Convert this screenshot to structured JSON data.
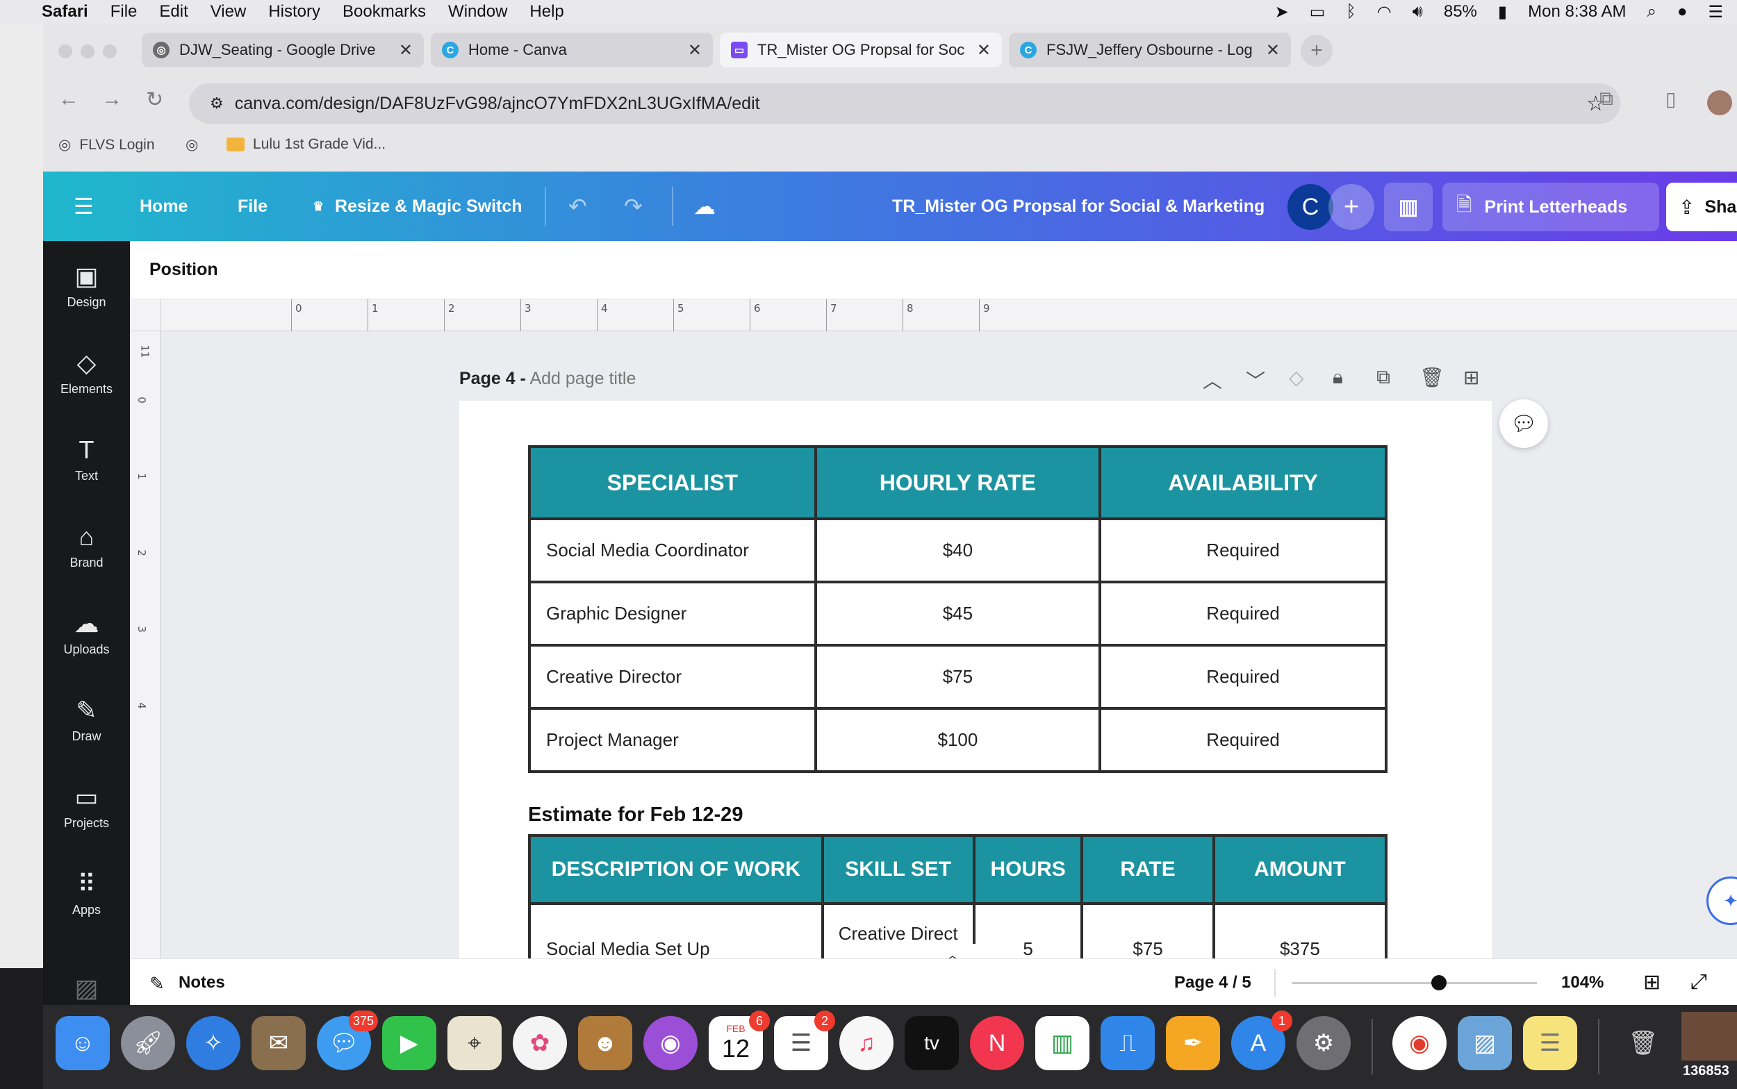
{
  "menubar": {
    "app": "Safari",
    "items": [
      "File",
      "Edit",
      "View",
      "History",
      "Bookmarks",
      "Window",
      "Help"
    ],
    "battery": "85%",
    "clock": "Mon 8:38 AM"
  },
  "browser": {
    "tabs": [
      {
        "label": "DJW_Seating - Google Drive",
        "icon": "globe-icon",
        "color": "#6b6b6b"
      },
      {
        "label": "Home - Canva",
        "icon": "canva-icon",
        "color": "#2aa6e0"
      },
      {
        "label": "TR_Mister OG Propsal for Soc",
        "icon": "canva-doc-icon",
        "color": "#7a4bf0"
      },
      {
        "label": "FSJW_Jeffery Osbourne - Log",
        "icon": "canva-icon",
        "color": "#2aa6e0"
      }
    ],
    "url": "canva.com/design/DAF8UzFvG98/ajncO7YmFDX2nL3UGxIfMA/edit",
    "bookmarks": [
      {
        "label": "FLVS Login"
      },
      {
        "label": ""
      },
      {
        "label": "Lulu 1st Grade Vid..."
      }
    ]
  },
  "canva": {
    "nav": {
      "home": "Home",
      "file": "File",
      "resize": "Resize & Magic Switch",
      "title": "TR_Mister OG Propsal for Social & Marketing",
      "avatar_letter": "C",
      "print": "Print Letterheads",
      "share": "Share"
    },
    "sidebar": [
      {
        "label": "Design",
        "icon": "▣"
      },
      {
        "label": "Elements",
        "icon": "◇"
      },
      {
        "label": "Text",
        "icon": "T"
      },
      {
        "label": "Brand",
        "icon": "⌂"
      },
      {
        "label": "Uploads",
        "icon": "☁"
      },
      {
        "label": "Draw",
        "icon": "✎"
      },
      {
        "label": "Projects",
        "icon": "▭"
      },
      {
        "label": "Apps",
        "icon": "⠿"
      }
    ],
    "position_label": "Position",
    "ruler_h": [
      "0",
      "1",
      "2",
      "3",
      "4",
      "5",
      "6",
      "7",
      "8",
      "9"
    ],
    "ruler_v": [
      "11",
      "0",
      "1",
      "2",
      "3",
      "4"
    ],
    "page_label": "Page 4 -",
    "page_title_placeholder": "Add page title",
    "table1": {
      "headers": [
        "SPECIALIST",
        "HOURLY RATE",
        "AVAILABILITY"
      ],
      "rows": [
        [
          "Social Media Coordinator",
          "$40",
          "Required"
        ],
        [
          "Graphic Designer",
          "$45",
          "Required"
        ],
        [
          "Creative Director",
          "$75",
          "Required"
        ],
        [
          "Project Manager",
          "$100",
          "Required"
        ]
      ]
    },
    "estimate_title": "Estimate for Feb 12-29",
    "table2": {
      "headers": [
        "DESCRIPTION OF WORK",
        "SKILL SET",
        "HOURS",
        "RATE",
        "AMOUNT"
      ],
      "rows": [
        [
          "Social Media Set Up",
          "Creative Direct",
          "5",
          "$75",
          "$375"
        ]
      ]
    },
    "bottom": {
      "notes": "Notes",
      "page_count": "Page 4 / 5",
      "zoom": "104%",
      "zoom_level": 0.6
    }
  },
  "dock": {
    "badges": {
      "mail": "375",
      "calendar": "6",
      "reminders": "2",
      "appstore": "1"
    },
    "calendar_month": "FEB",
    "calendar_day": "12",
    "tv_label": "tv",
    "corner_text": "136853"
  }
}
